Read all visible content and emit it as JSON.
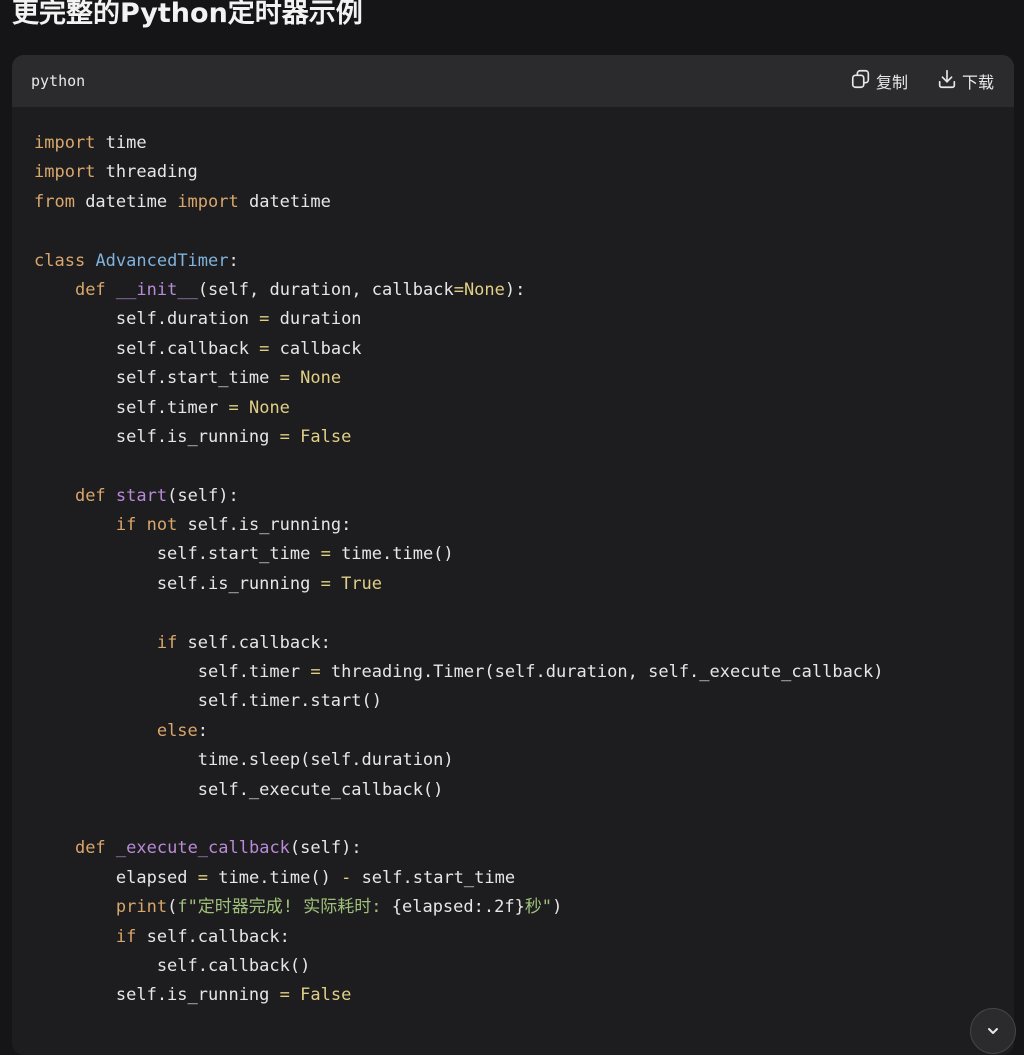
{
  "page": {
    "title": "更完整的Python定时器示例"
  },
  "code_block": {
    "language": "python",
    "copy_label": "复制",
    "download_label": "下载",
    "lines": [
      [
        [
          "kw",
          "import"
        ],
        [
          "t",
          " time"
        ]
      ],
      [
        [
          "kw",
          "import"
        ],
        [
          "t",
          " threading"
        ]
      ],
      [
        [
          "kw",
          "from"
        ],
        [
          "t",
          " datetime "
        ],
        [
          "kw",
          "import"
        ],
        [
          "t",
          " datetime"
        ]
      ],
      [],
      [
        [
          "kw",
          "class"
        ],
        [
          "t",
          " "
        ],
        [
          "cls",
          "AdvancedTimer"
        ],
        [
          "t",
          ":"
        ]
      ],
      [
        [
          "t",
          "    "
        ],
        [
          "kw",
          "def"
        ],
        [
          "t",
          " "
        ],
        [
          "fn",
          "__init__"
        ],
        [
          "t",
          "(self, duration, callback"
        ],
        [
          "op",
          "="
        ],
        [
          "lit",
          "None"
        ],
        [
          "t",
          "):"
        ]
      ],
      [
        [
          "t",
          "        self.duration "
        ],
        [
          "op",
          "="
        ],
        [
          "t",
          " duration"
        ]
      ],
      [
        [
          "t",
          "        self.callback "
        ],
        [
          "op",
          "="
        ],
        [
          "t",
          " callback"
        ]
      ],
      [
        [
          "t",
          "        self.start_time "
        ],
        [
          "op",
          "="
        ],
        [
          "t",
          " "
        ],
        [
          "lit",
          "None"
        ]
      ],
      [
        [
          "t",
          "        self.timer "
        ],
        [
          "op",
          "="
        ],
        [
          "t",
          " "
        ],
        [
          "lit",
          "None"
        ]
      ],
      [
        [
          "t",
          "        self.is_running "
        ],
        [
          "op",
          "="
        ],
        [
          "t",
          " "
        ],
        [
          "lit",
          "False"
        ]
      ],
      [],
      [
        [
          "t",
          "    "
        ],
        [
          "kw",
          "def"
        ],
        [
          "t",
          " "
        ],
        [
          "fn",
          "start"
        ],
        [
          "t",
          "(self):"
        ]
      ],
      [
        [
          "t",
          "        "
        ],
        [
          "kw",
          "if not"
        ],
        [
          "t",
          " self.is_running:"
        ]
      ],
      [
        [
          "t",
          "            self.start_time "
        ],
        [
          "op",
          "="
        ],
        [
          "t",
          " time.time()"
        ]
      ],
      [
        [
          "t",
          "            self.is_running "
        ],
        [
          "op",
          "="
        ],
        [
          "t",
          " "
        ],
        [
          "lit",
          "True"
        ]
      ],
      [],
      [
        [
          "t",
          "            "
        ],
        [
          "kw",
          "if"
        ],
        [
          "t",
          " self.callback:"
        ]
      ],
      [
        [
          "t",
          "                self.timer "
        ],
        [
          "op",
          "="
        ],
        [
          "t",
          " threading.Timer(self.duration, self._execute_callback)"
        ]
      ],
      [
        [
          "t",
          "                self.timer.start()"
        ]
      ],
      [
        [
          "t",
          "            "
        ],
        [
          "kw",
          "else"
        ],
        [
          "t",
          ":"
        ]
      ],
      [
        [
          "t",
          "                time.sleep(self.duration)"
        ]
      ],
      [
        [
          "t",
          "                self._execute_callback()"
        ]
      ],
      [],
      [
        [
          "t",
          "    "
        ],
        [
          "kw",
          "def"
        ],
        [
          "t",
          " "
        ],
        [
          "fn",
          "_execute_callback"
        ],
        [
          "t",
          "(self):"
        ]
      ],
      [
        [
          "t",
          "        elapsed "
        ],
        [
          "op",
          "="
        ],
        [
          "t",
          " time.time() "
        ],
        [
          "op",
          "-"
        ],
        [
          "t",
          " self.start_time"
        ]
      ],
      [
        [
          "t",
          "        "
        ],
        [
          "kw",
          "print"
        ],
        [
          "t",
          "("
        ],
        [
          "str",
          "f\"定时器完成! 实际耗时: "
        ],
        [
          "t",
          "{elapsed:.2f}"
        ],
        [
          "str",
          "秒\""
        ],
        [
          "t",
          ")"
        ]
      ],
      [
        [
          "t",
          "        "
        ],
        [
          "kw",
          "if"
        ],
        [
          "t",
          " self.callback:"
        ]
      ],
      [
        [
          "t",
          "            self.callback()"
        ]
      ],
      [
        [
          "t",
          "        self.is_running "
        ],
        [
          "op",
          "="
        ],
        [
          "t",
          " "
        ],
        [
          "lit",
          "False"
        ]
      ]
    ]
  },
  "colors": {
    "background": "#151517",
    "code_background": "#1d1d1f",
    "header_background": "#2b2b2e",
    "keyword": "#d9a66b",
    "class_name": "#7fb2dc",
    "function_name": "#b98ad6",
    "literal": "#e0cf85",
    "string": "#9fc07a"
  },
  "icons": {
    "copy": "copy-icon",
    "download": "download-icon",
    "scroll": "chevron-down-icon"
  }
}
